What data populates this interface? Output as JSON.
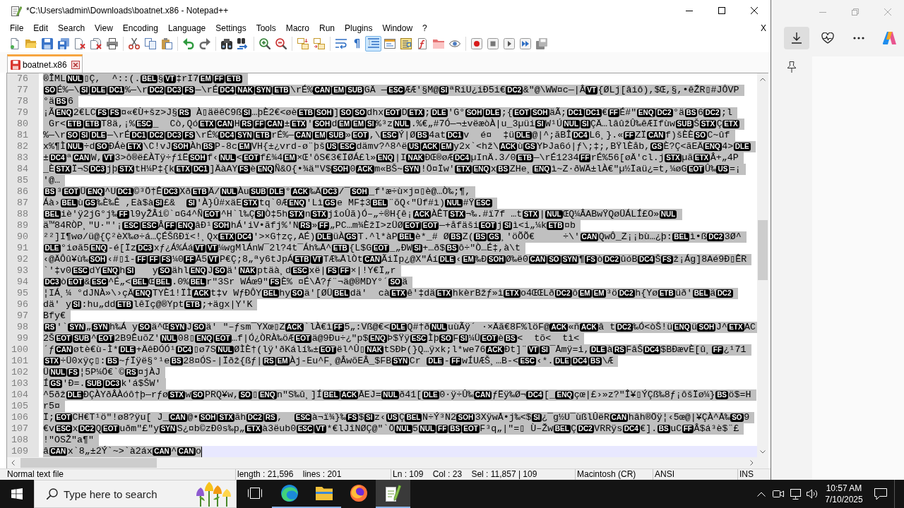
{
  "window": {
    "title": "*C:\\Users\\admin\\Downloads\\boatnet.x86 - Notepad++"
  },
  "menu": {
    "items": [
      "File",
      "Edit",
      "Search",
      "View",
      "Encoding",
      "Language",
      "Settings",
      "Tools",
      "Macro",
      "Run",
      "Plugins",
      "Window",
      "?"
    ],
    "close_label": "X"
  },
  "toolbar": [
    [
      {
        "kind": "new",
        "on": false
      },
      {
        "kind": "open",
        "on": false
      },
      {
        "kind": "save",
        "on": false
      },
      {
        "kind": "saveall",
        "on": false
      },
      {
        "kind": "close",
        "on": false
      },
      {
        "kind": "closeall",
        "on": false
      },
      {
        "kind": "print",
        "on": false
      }
    ],
    [
      {
        "kind": "cut",
        "on": false
      },
      {
        "kind": "copy",
        "on": false
      },
      {
        "kind": "paste",
        "on": false
      }
    ],
    [
      {
        "kind": "undo",
        "on": false
      },
      {
        "kind": "redo",
        "on": false
      }
    ],
    [
      {
        "kind": "find",
        "on": false
      },
      {
        "kind": "replace",
        "on": false
      }
    ],
    [
      {
        "kind": "zoomin",
        "on": false
      },
      {
        "kind": "zoomout",
        "on": false
      }
    ],
    [
      {
        "kind": "syncv",
        "on": false
      },
      {
        "kind": "synch",
        "on": false
      }
    ],
    [
      {
        "kind": "wrap",
        "on": false
      },
      {
        "kind": "glyph",
        "label": "¶",
        "on": false
      },
      {
        "kind": "indent",
        "on": true
      },
      {
        "kind": "udl",
        "on": false
      },
      {
        "kind": "docmap",
        "on": false
      },
      {
        "kind": "funclist",
        "on": false
      },
      {
        "kind": "workspace",
        "on": false
      },
      {
        "kind": "monitor",
        "on": false
      }
    ],
    [
      {
        "kind": "record",
        "on": false
      },
      {
        "kind": "stop",
        "on": false
      },
      {
        "kind": "play",
        "on": false
      },
      {
        "kind": "playmulti",
        "on": false
      },
      {
        "kind": "savemacro",
        "on": false
      }
    ]
  ],
  "tabs": [
    {
      "label": "boatnet.x86",
      "selected": true,
      "modified": true
    }
  ],
  "editor": {
    "lines": [
      {
        "number": "76",
        "selected": true,
        "current": false,
        "segments": [
          "®ÎML",
          {
            "control": "NUL"
          },
          "▯Ç,  ^::(.",
          {
            "control": "BEL"
          },
          "§",
          {
            "control": "VT"
          },
          "‡rI7",
          {
            "control": "EM"
          },
          {
            "control": "FF"
          },
          {
            "control": "ETB"
          }
        ]
      },
      {
        "number": "77",
        "selected": true,
        "current": false,
        "segments": [
          {
            "control": "SO"
          },
          "É%—\\",
          {
            "control": "SI"
          },
          {
            "control": "DLE"
          },
          {
            "control": "DC1"
          },
          "%—\\r",
          {
            "control": "DC2"
          },
          {
            "control": "DC3"
          },
          {
            "control": "FS"
          },
          "—\\rÉ",
          {
            "control": "DC4"
          },
          {
            "control": "NAK"
          },
          {
            "control": "SYN"
          },
          {
            "control": "ETB"
          },
          "\\rÉ%",
          {
            "control": "CAN"
          },
          {
            "control": "EM"
          },
          {
            "control": "SUB"
          },
          "GÄ —",
          {
            "control": "ESC"
          },
          "ÆÆ'§M@",
          {
            "control": "SI"
          },
          "ªRiU¿iÐ5i€",
          {
            "control": "DC2"
          },
          "&\"@\\WW¤c—|Â",
          {
            "control": "VT"
          },
          "{ØLj[âiô),$Œ,§,•êŽR▯#JÔVP"
        ]
      },
      {
        "number": "78",
        "selected": true,
        "current": false,
        "segments": [
          "°ä",
          {
            "control": "BS"
          },
          "6"
        ]
      },
      {
        "number": "79",
        "selected": true,
        "current": false,
        "segments": [
          "¡Ã",
          {
            "control": "ENQ"
          },
          "2€LC",
          {
            "control": "FS"
          },
          {
            "control": "FS"
          },
          "¤«€Ù+šz>J§",
          {
            "control": "RS"
          },
          " À▯äëêC9ß",
          {
            "control": "SI"
          },
          "…þÈ2€<øè",
          {
            "control": "ETB"
          },
          {
            "control": "SOH"
          },
          "]",
          {
            "control": "SO"
          },
          {
            "control": "SO"
          },
          "dhx",
          {
            "control": "EOT"
          },
          "D",
          {
            "control": "ETX"
          },
          ";",
          {
            "control": "DLE"
          },
          "'G°",
          {
            "control": "SOH"
          },
          {
            "control": "DLE"
          },
          ";{",
          {
            "control": "EOT"
          },
          {
            "control": "SOH"
          },
          "äÃ;",
          {
            "control": "DC1"
          },
          {
            "control": "DC1"
          },
          "€",
          {
            "control": "FF"
          },
          "É#\"",
          {
            "control": "ENQ"
          },
          {
            "control": "DC2"
          },
          "°ä",
          {
            "control": "BS"
          },
          "6",
          {
            "control": "DC2"
          },
          ";l"
        ]
      },
      {
        "number": "80",
        "selected": true,
        "current": false,
        "segments": [
          " Gr<",
          {
            "control": "ETB"
          },
          {
            "control": "ETB"
          },
          "T8ä,¡%",
          {
            "control": "ESC"
          },
          "_  Cò,Qó",
          {
            "control": "ETX"
          },
          {
            "control": "CAN"
          },
          "H",
          {
            "control": "RS"
          },
          {
            "control": "FF"
          },
          {
            "control": "CAN"
          },
          "±",
          {
            "control": "ETX"
          },
          "'",
          {
            "control": "SOH"
          },
          "d",
          {
            "control": "EM"
          },
          {
            "control": "EM"
          },
          {
            "control": "SI"
          },
          "%³z",
          {
            "control": "NUL"
          },
          ".%€„#7Ó—¬±vëæòÀ|u_3µüi",
          {
            "control": "SI"
          },
          "W¹Ú",
          {
            "control": "NUL"
          },
          {
            "control": "SI"
          },
          "ÇÄ…lâûžÛ‰êÆIfùw",
          {
            "control": "SUB"
          },
          "Š",
          {
            "control": "STX"
          },
          "Ç",
          {
            "control": "ETX"
          }
        ]
      },
      {
        "number": "81",
        "selected": true,
        "current": false,
        "segments": [
          "%—\\r",
          {
            "control": "SO"
          },
          {
            "control": "SI"
          },
          {
            "control": "DLE"
          },
          "—\\rÉ",
          {
            "control": "DC1"
          },
          {
            "control": "DC2"
          },
          {
            "control": "DC3"
          },
          {
            "control": "FS"
          },
          "\\rÉ%",
          {
            "control": "DC4"
          },
          {
            "control": "SYN"
          },
          {
            "control": "ETB"
          },
          "rÉ%—",
          {
            "control": "CAN"
          },
          {
            "control": "EM"
          },
          {
            "control": "SUB"
          },
          "»",
          {
            "control": "EOT"
          },
          ",\\",
          {
            "control": "ESC"
          },
          "Ý|Ø",
          {
            "control": "BS"
          },
          "4at",
          {
            "control": "DC1"
          },
          "v  é¤  ‡ü",
          {
            "control": "DLE"
          },
          "@|^;ãBÎ",
          {
            "control": "DC4"
          },
          "L6¸}.«",
          {
            "control": "FF"
          },
          "ZÏ",
          {
            "control": "CAN"
          },
          "f)šÈÈ",
          {
            "control": "SO"
          },
          "C~ûf"
        ]
      },
      {
        "number": "82",
        "selected": true,
        "current": false,
        "segments": [
          "x%¶Ì",
          {
            "control": "NUL"
          },
          "÷d",
          {
            "control": "SO"
          },
          "ÐÁè",
          {
            "control": "ETX"
          },
          "\\C!vJ",
          {
            "control": "SOH"
          },
          "Àh",
          {
            "control": "BS"
          },
          "P-8c",
          {
            "control": "EM"
          },
          "VH{±¿vrd-ø¨þš",
          {
            "control": "US"
          },
          {
            "control": "ESC"
          },
          "dämv?^8^ë",
          {
            "control": "US"
          },
          {
            "control": "ACK"
          },
          {
            "control": "EM"
          },
          "y2x`<hž\\",
          {
            "control": "ACK"
          },
          "ù",
          {
            "control": "GS"
          },
          "YÞJa6ó|ƒ\\;‡;,BŸlÈåb,",
          {
            "control": "GS"
          },
          "È?Ç<ãEÄ",
          {
            "control": "ENQ"
          },
          "4>",
          {
            "control": "DLE"
          }
        ]
      },
      {
        "number": "83",
        "selected": true,
        "current": false,
        "segments": [
          "±",
          {
            "control": "DC4"
          },
          "ª",
          {
            "control": "CAN"
          },
          "W,",
          {
            "control": "VT"
          },
          "3>ô®ë£ÀTÿ÷ƒîË",
          {
            "control": "SOH"
          },
          "f‹",
          {
            "control": "NUL"
          },
          "<",
          {
            "control": "EOT"
          },
          "f£¾4",
          {
            "control": "EM"
          },
          "×Œ'ôS€3€ÏØÁ£l»",
          {
            "control": "ENQ"
          },
          "|I",
          {
            "control": "NAK"
          },
          "ÐŒ®øÆ",
          {
            "control": "DC4"
          },
          "µInÄ.3/0",
          {
            "control": "ETB"
          },
          "—\\rÉ1234",
          {
            "control": "FF"
          },
          "rÉ%56[øÄ'cl.j",
          {
            "control": "STX"
          },
          "µã",
          {
            "control": "ETX"
          },
          "Â+„4P"
        ]
      },
      {
        "number": "84",
        "selected": true,
        "current": false,
        "segments": [
          "_È",
          {
            "control": "STX"
          },
          "Ï¬S",
          {
            "control": "DC3"
          },
          "jþ",
          {
            "control": "STX"
          },
          "tH¼P‡{k",
          {
            "control": "ETX"
          },
          {
            "control": "DC1"
          },
          "]ÄàAY",
          {
            "control": "FS"
          },
          "è",
          {
            "control": "ENQ"
          },
          "Ñ&O{•¾ä\"V$",
          {
            "control": "SOH"
          },
          "0",
          {
            "control": "ACK"
          },
          "m«BŠ~",
          {
            "control": "SYN"
          },
          "!Ö¤Ïw'",
          {
            "control": "ETX"
          },
          {
            "control": "ENQ"
          },
          "x",
          {
            "control": "BS"
          },
          "ZHe¸",
          {
            "control": "ENQ"
          },
          "ì~Z·ðWÄ±lÀ€\"µ½Ïaü¿=t,¼øG",
          {
            "control": "EOT"
          },
          "Û‰",
          {
            "control": "US"
          },
          "=¡"
        ]
      },
      {
        "number": "85",
        "selected": true,
        "current": false,
        "segments": [
          "'@…"
        ]
      },
      {
        "number": "86",
        "selected": true,
        "current": false,
        "segments": [
          {
            "control": "BS"
          },
          "³",
          {
            "control": "EOT"
          },
          "Ü",
          {
            "control": "ENQ"
          },
          "^U",
          {
            "control": "DC1"
          },
          "©³Ö†Ê",
          {
            "control": "DC3"
          },
          "Xð",
          {
            "control": "ETB"
          },
          "Ä/",
          {
            "control": "NUL"
          },
          "Àu",
          {
            "control": "SUB"
          },
          {
            "control": "DLE"
          },
          "°",
          {
            "control": "ACK"
          },
          "‰Ä",
          {
            "control": "DC3"
          },
          "/¯",
          {
            "control": "SOH"
          },
          "_f'æ÷ù×j¤▯è@…Ò‰;¶,"
        ]
      },
      {
        "number": "87",
        "selected": true,
        "current": false,
        "segments": [
          "Áà›",
          {
            "control": "BEL"
          },
          "ù",
          {
            "control": "GS"
          },
          "‰È‰Ê ,Eà$à",
          {
            "control": "SI"
          },
          "£&  ",
          {
            "control": "SI"
          },
          "'À}Û#xäE",
          {
            "control": "STX"
          },
          "tq`0Æ",
          {
            "control": "ENQ"
          },
          "'Lì",
          {
            "control": "GS"
          },
          "e MF‡3",
          {
            "control": "BEL"
          },
          "¨õQ‹\"Üf#ì)",
          {
            "control": "NUL"
          },
          "#Ÿ",
          {
            "control": "ESC"
          }
        ]
      },
      {
        "number": "88",
        "selected": true,
        "current": false,
        "segments": [
          {
            "control": "BEL"
          },
          "iè'ÿ2jG°j‰",
          {
            "control": "FF"
          },
          "l9yŽÂi©`¤G4^Ñ",
          {
            "control": "EOT"
          },
          "^H`l‰Ç",
          {
            "control": "SI"
          },
          "Ò‡5h",
          {
            "control": "STX"
          },
          "n",
          {
            "control": "STX"
          },
          "jîoÛã)Ó–„÷®H{ê¡",
          {
            "control": "ACK"
          },
          "ÀÊT",
          {
            "control": "STX"
          },
          "¬‰.#ï7f …t",
          {
            "control": "STX"
          },
          "|",
          {
            "control": "NUL"
          },
          "ŒQ¼ÂABwŸQøÜÁLÍ£O»",
          {
            "control": "NUL"
          }
        ]
      },
      {
        "number": "89",
        "selected": true,
        "current": false,
        "segments": [
          "ä™84RÒP¸\"U·\"'¡",
          {
            "control": "ESC"
          },
          {
            "control": "ESC"
          },
          "Â",
          {
            "control": "FF"
          },
          {
            "control": "ENQ"
          },
          "âÐ¹",
          {
            "control": "SOH"
          },
          "hÁ'iV•ãfj%'N",
          {
            "control": "RS"
          },
          "»",
          {
            "control": "FF"
          },
          "„PC…m¾ÈžI>zÜØ",
          {
            "control": "EOT"
          },
          {
            "control": "EOT"
          },
          "—+åfäši",
          {
            "control": "EOT"
          },
          "j",
          {
            "control": "SI"
          },
          "ì<i„¼k",
          {
            "control": "ETB"
          },
          "¤b"
        ]
      },
      {
        "number": "90",
        "selected": true,
        "current": false,
        "segments": [
          "²²]I¶wø/ü@{Ç²èX‰ø÷á…ÇÉŠßÐï<!¸Qx",
          {
            "control": "ETX"
          },
          {
            "control": "DC4"
          },
          "'>×G†zç,AÉ)",
          {
            "control": "DLE"
          },
          "üÀ",
          {
            "control": "GS"
          },
          "T.^l*àP",
          {
            "control": "BEL"
          },
          "è*_# Ø",
          {
            "control": "BS"
          },
          "Z(",
          {
            "control": "BS"
          },
          {
            "control": "GS"
          },
          "¸'öÕÕ€     ÷\\'",
          {
            "control": "CAN"
          },
          "QwÔ_Z¡¡bù…¿þ:",
          {
            "control": "BEL"
          },
          "ì•ß",
          {
            "control": "DC2"
          },
          "3Ø^"
        ]
      },
      {
        "number": "91",
        "selected": true,
        "current": false,
        "segments": [
          {
            "control": "DLE"
          },
          "°iøã5",
          {
            "control": "ENQ"
          },
          "-é[Ïz",
          {
            "control": "DC3"
          },
          "xƒ¿Á%Áá",
          {
            "control": "VT"
          },
          {
            "control": "VT"
          },
          "¼wgMlÁnW¯2l?4t¯Áh‰Å^",
          {
            "control": "ETB"
          },
          "{L$G",
          {
            "control": "EOT"
          },
          "_„ÐW",
          {
            "control": "SI"
          },
          "+…ð$",
          {
            "control": "BS"
          },
          "ô÷\"Ò…É‡,à\\t"
        ]
      },
      {
        "number": "92",
        "selected": true,
        "current": false,
        "segments": [
          "‹@ÄÔû¥ù‰",
          {
            "control": "SOH"
          },
          "‹#▯î-",
          {
            "control": "FF"
          },
          {
            "control": "FF"
          },
          {
            "control": "FS"
          },
          "¼0",
          {
            "control": "FF"
          },
          "Å5",
          {
            "control": "VT"
          },
          "P€Ç;8„ªy6tJpÁ",
          {
            "control": "ETB"
          },
          {
            "control": "VT"
          },
          "TÆ‰ÅlÒt",
          {
            "control": "CAN"
          },
          "ÃiÏp¿@X\"Áí",
          {
            "control": "DLE"
          },
          "‹",
          {
            "control": "EM"
          },
          "‰Ð",
          {
            "control": "SOH"
          },
          "Ø‰ë0",
          {
            "control": "CAN"
          },
          {
            "control": "SO"
          },
          {
            "control": "SYN"
          },
          "¶",
          {
            "control": "FS"
          },
          "ò",
          {
            "control": "DC2"
          },
          "ûóB",
          {
            "control": "DC4"
          },
          "Š",
          {
            "control": "FS"
          },
          "ž¡Ág]8Aé9Ð▯ÊR"
        ]
      },
      {
        "number": "93",
        "selected": true,
        "current": false,
        "segments": [
          "`'‡v0",
          {
            "control": "ESC"
          },
          "dY",
          {
            "control": "ENQ"
          },
          "h",
          {
            "control": "SI"
          },
          "   y",
          {
            "control": "SO"
          },
          "ähl",
          {
            "control": "ENQ"
          },
          "J",
          {
            "control": "SO"
          },
          "ä'",
          {
            "control": "NAK"
          },
          "ptäà¸d",
          {
            "control": "ESC"
          },
          "xë|",
          {
            "control": "FS"
          },
          {
            "control": "FF"
          },
          "×|!Y€Ï„r"
        ]
      },
      {
        "number": "94",
        "selected": true,
        "current": false,
        "segments": [
          {
            "control": "DC3"
          },
          "ò",
          {
            "control": "EOT"
          },
          "&",
          {
            "control": "ESC"
          },
          "^É„<",
          {
            "control": "BEL"
          },
          "Œ",
          {
            "control": "BEL"
          },
          ".0%",
          {
            "control": "BEL"
          },
          "r\"3Sr WÁœ9\"",
          {
            "control": "FS"
          },
          "È% ¤É\\Å?ƒ¨¬ä@®MDY°´",
          {
            "control": "SO"
          },
          "ä"
        ]
      },
      {
        "number": "95",
        "selected": true,
        "current": false,
        "segments": [
          "¦IÁ¸¼ °dJNÀ»\\›çÄ",
          {
            "control": "ENQ"
          },
          "TYÈ1!ÏÌ",
          {
            "control": "ACK"
          },
          "t‡v WƒÐÔY",
          {
            "control": "BEL"
          },
          "hy",
          {
            "control": "SO"
          },
          "ä'[ØÜ",
          {
            "control": "BEL"
          },
          "dä'  cà",
          {
            "control": "ETX"
          },
          "ê'‡dä",
          {
            "control": "ETX"
          },
          "hkèrBžƒ»ì",
          {
            "control": "ETX"
          },
          "o4ŒŒLð",
          {
            "control": "DC2"
          },
          "ô",
          {
            "control": "EM"
          },
          {
            "control": "EM"
          },
          "³ö",
          {
            "control": "DC2"
          },
          "h{Yø",
          {
            "control": "ETB"
          },
          "üð'",
          {
            "control": "BEL"
          },
          "ä",
          {
            "control": "DC2"
          }
        ]
      },
      {
        "number": "96",
        "selected": true,
        "current": false,
        "segments": [
          "dä' y",
          {
            "control": "SI"
          },
          ":hu„dd",
          {
            "control": "ETB"
          },
          "lêIç@®Ypt",
          {
            "control": "ETB"
          },
          ";+ägx|Y'K"
        ]
      },
      {
        "number": "97",
        "selected": true,
        "current": false,
        "segments": [
          "Bfy€"
        ]
      },
      {
        "number": "98",
        "selected": true,
        "current": false,
        "segments": [
          {
            "control": "RS"
          },
          "'`",
          {
            "control": "SYN"
          },
          "„",
          {
            "control": "SYN"
          },
          "h‰Á y",
          {
            "control": "SO"
          },
          "ä^Œ",
          {
            "control": "SYN"
          },
          "J",
          {
            "control": "SO"
          },
          "ä' \"–ƒsm¯YXœ▯Z",
          {
            "control": "ACK"
          },
          "`lÀ€ì",
          {
            "control": "FF"
          },
          "5„:Vß@€<",
          {
            "control": "DLE"
          },
          "Q#†ð",
          {
            "control": "NUL"
          },
          "uùÃÿ´ ·×Äã€8F%löF@",
          {
            "control": "ACK"
          },
          "«ñ",
          {
            "control": "ACK"
          },
          "â t",
          {
            "control": "DC2"
          },
          "‰Ó<òŠ!ü",
          {
            "control": "ENQ"
          },
          "ü",
          {
            "control": "SOH"
          },
          "J^",
          {
            "control": "ETX"
          },
          "AC"
        ]
      },
      {
        "number": "99",
        "selected": true,
        "current": false,
        "segments": [
          "2Š",
          {
            "control": "EOT"
          },
          {
            "control": "SUB"
          },
          "^",
          {
            "control": "EOT"
          },
          "2B9ÊuõZ'",
          {
            "control": "NUL"
          },
          "08▯",
          {
            "control": "ENQ"
          },
          {
            "control": "EOT"
          },
          "…f|Ó¿ÒRÀ‰öÆ",
          {
            "control": "EOT"
          },
          "ä@9Ðu÷¿\"p$",
          {
            "control": "ENQ"
          },
          "Þ$Ÿÿ",
          {
            "control": "ESC"
          },
          "Ìþ",
          {
            "control": "SO"
          },
          "F",
          {
            "control": "SI"
          },
          "¼Ü",
          {
            "control": "EOT"
          },
          "è",
          {
            "control": "BS"
          },
          "<  tõ<  tì<"
        ]
      },
      {
        "number": "100",
        "selected": true,
        "current": false,
        "segments": [
          "´ƒ",
          {
            "control": "CAN"
          },
          "øtè€ù-Ì*",
          {
            "control": "DLE"
          },
          "+ÄêÐÓÓ¹",
          {
            "control": "DC4"
          },
          "▯ø7S",
          {
            "control": "NUL"
          },
          "ØÌÈ†(lÿ'ðKálí‰±",
          {
            "control": "EOT"
          },
          "ël^Û▯",
          {
            "control": "NAK"
          },
          "tSÐÞ(}Q…ÿxk;l*we76",
          {
            "control": "ACK"
          },
          "Ðt]¨",
          {
            "control": "VT"
          },
          {
            "control": "SI"
          },
          "¯Åmÿ=i,",
          {
            "control": "DLE"
          },
          "à",
          {
            "control": "RS"
          },
          "FâŠ",
          {
            "control": "DC4"
          },
          "$BÐævÈ[û¸",
          {
            "control": "FF"
          },
          "¿¹71"
        ]
      },
      {
        "number": "101",
        "selected": true,
        "current": false,
        "segments": [
          {
            "control": "STX"
          },
          "÷Ü0xÿç▯:",
          {
            "control": "BS"
          },
          "~ƒÏÿë§°¹e",
          {
            "control": "BS"
          },
          "28¤ÓS-|Ïðž{ßƒ|",
          {
            "control": "RS"
          },
          {
            "control": "EM"
          },
          "Àj-Eu^F¸@ÂwõEÂ_$FB",
          {
            "control": "SYN"
          },
          "Cr ",
          {
            "control": "DLE"
          },
          "-",
          {
            "control": "FF"
          },
          "wÍUÆŠ¸…B-<",
          {
            "control": "ESC"
          },
          "‹*.",
          {
            "control": "DLE"
          },
          {
            "control": "DC4"
          },
          {
            "control": "BS"
          },
          "\\Æ"
        ]
      },
      {
        "number": "102",
        "selected": true,
        "current": false,
        "segments": [
          "Ü",
          {
            "control": "NUL"
          },
          {
            "control": "FS"
          },
          "¦5P¼Ö€`©",
          {
            "control": "RS"
          },
          "¤jÀJ"
        ]
      },
      {
        "number": "103",
        "selected": true,
        "current": false,
        "segments": [
          "Í",
          {
            "control": "GS"
          },
          "'Ð=.",
          {
            "control": "SUB"
          },
          {
            "control": "DC3"
          },
          "k'á$ŠW'"
        ]
      },
      {
        "number": "104",
        "selected": true,
        "current": false,
        "segments": [
          "^5ðž",
          {
            "control": "DLE"
          },
          "ÐÇÀYðÂÀóô†þ—rƒø",
          {
            "control": "STX"
          },
          "w",
          {
            "control": "SO"
          },
          "PRQ¥w,",
          {
            "control": "SO"
          },
          "▯",
          {
            "control": "ENQ"
          },
          "n\"S‰û¸]Í",
          {
            "control": "BEL"
          },
          {
            "control": "ACK"
          },
          "ÅEJ=",
          {
            "control": "NUL"
          },
          "ð41[",
          {
            "control": "DLE"
          },
          "0·ÿ÷Û‰",
          {
            "control": "CAN"
          },
          "ƒËÿ‰Ø¬",
          {
            "control": "DC4"
          },
          "[_",
          {
            "control": "ENQ"
          },
          "çœ|£›»z?\"Î¥▯ÝÇß‰8ƒ¡ôšÏø¼}",
          {
            "control": "BS"
          },
          "ö$=H"
        ]
      },
      {
        "number": "105",
        "selected": true,
        "current": false,
        "segments": [
          "r5¤"
        ]
      },
      {
        "number": "106",
        "selected": true,
        "current": false,
        "segments": [
          "Ï;",
          {
            "control": "EOT"
          },
          "CH€T¹ö\"!ø8?ÿu[ J_",
          {
            "control": "CAN"
          },
          "@•",
          {
            "control": "SOH"
          },
          {
            "control": "STX"
          },
          "ãh",
          {
            "control": "DC2"
          },
          {
            "control": "RS"
          },
          ",  ",
          {
            "control": "ESC"
          },
          "à¬ï¾}‰",
          {
            "control": "FS"
          },
          "$",
          {
            "control": "SI"
          },
          "z‹",
          {
            "control": "US"
          },
          "Ç",
          {
            "control": "BEL"
          },
          "N÷Ý³N2",
          {
            "control": "SOH"
          },
          "3XÿwÅ•j‰<$",
          {
            "control": "SI"
          },
          "¿¯g½U¯ùßlÛëR",
          {
            "control": "CAN"
          },
          "hâh®Öÿ¦‹5œ@|¥ÇÀ^Å‰",
          {
            "control": "SO"
          },
          "9"
        ]
      },
      {
        "number": "107",
        "selected": true,
        "current": false,
        "segments": [
          "€v",
          {
            "control": "ESC"
          },
          "x",
          {
            "control": "DC2"
          },
          "Q",
          {
            "control": "EOT"
          },
          "uðm\"£\"y",
          {
            "control": "SYN"
          },
          "S¿¤b©zÐ0s‰p„",
          {
            "control": "ETX"
          },
          "à3ëub0",
          {
            "control": "ESC"
          },
          {
            "control": "VT"
          },
          "*€lJîNØÇ@\"`Ö",
          {
            "control": "NUL"
          },
          "5",
          {
            "control": "NUL"
          },
          {
            "control": "FF"
          },
          {
            "control": "BS"
          },
          {
            "control": "EOT"
          },
          "F³q„|\"=▯ Ù–Žw",
          {
            "control": "BEL"
          },
          "Ç",
          {
            "control": "DC2"
          },
          "VRRÿs",
          {
            "control": "DC4"
          },
          "€].",
          {
            "control": "BS"
          },
          "uC",
          {
            "control": "FF"
          },
          "Â$á³è$¨£"
        ]
      },
      {
        "number": "108",
        "selected": true,
        "current": false,
        "segments": [
          "!\"OSŽ\"a¶\""
        ]
      },
      {
        "number": "109",
        "selected": true,
        "current": true,
        "segments": [
          "â",
          {
            "control": "CAN"
          },
          "x`8„±2Ý`~>`à2áx",
          {
            "control": "CAN"
          },
          "^",
          {
            "control": "CAN"
          },
          "o"
        ]
      }
    ]
  },
  "status_bar": {
    "items": [
      "Normal text file",
      "length : 21,596    lines : 201",
      "Ln : 109    Col : 23    Sel : 11,857 | 109",
      "Macintosh (CR)",
      "ANSI",
      "INS"
    ]
  },
  "browser": {
    "toolbar": [
      {
        "kind": "download",
        "selected": true
      },
      {
        "kind": "heart",
        "selected": false
      },
      {
        "kind": "more",
        "selected": false
      },
      {
        "kind": "copilot",
        "selected": false
      }
    ]
  },
  "taskbar": {
    "search": {
      "placeholder": "Type here to search"
    },
    "apps": [
      {
        "kind": "taskview",
        "active": false,
        "running": false
      },
      {
        "kind": "edge",
        "active": false,
        "running": true
      },
      {
        "kind": "explorer",
        "active": false,
        "running": true
      },
      {
        "kind": "firefox",
        "active": false,
        "running": false
      },
      {
        "kind": "notepad",
        "active": true,
        "running": true
      }
    ],
    "clock": {
      "time": "10:57 AM",
      "date": "7/10/2025"
    }
  }
}
